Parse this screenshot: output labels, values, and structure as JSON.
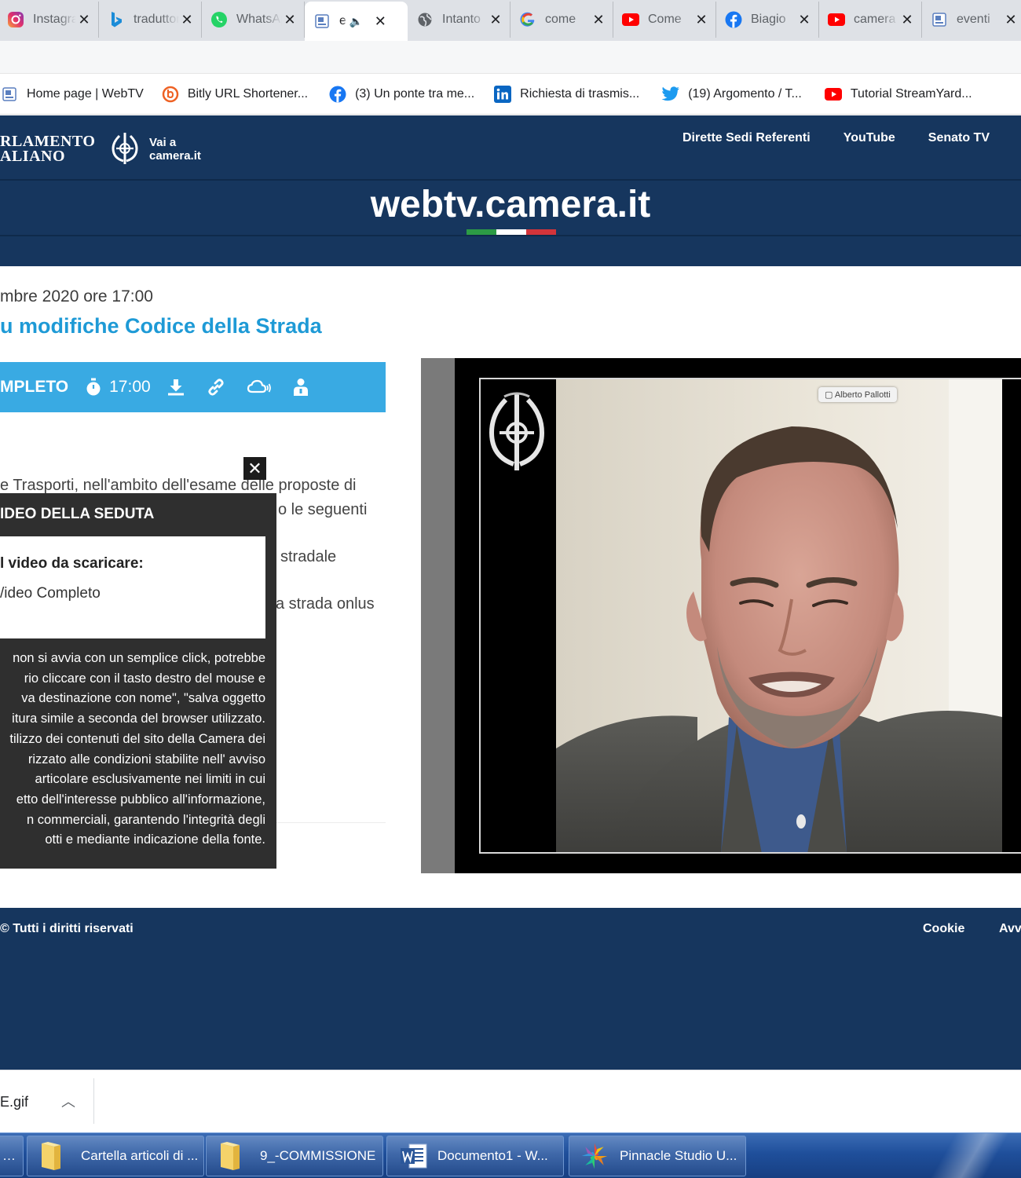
{
  "browser": {
    "tabs": [
      {
        "title": "Instagram",
        "icon": "instagram-icon",
        "active": false
      },
      {
        "title": "traduttore",
        "icon": "bing-icon",
        "active": false
      },
      {
        "title": "WhatsApp",
        "icon": "whatsapp-icon",
        "active": false
      },
      {
        "title": "e",
        "icon": "webtv-icon",
        "active": true
      },
      {
        "title": "Intanto",
        "icon": "globe-icon",
        "active": false
      },
      {
        "title": "come",
        "icon": "google-icon",
        "active": false
      },
      {
        "title": "Come",
        "icon": "youtube-icon",
        "active": false
      },
      {
        "title": "Biagio",
        "icon": "facebook-icon",
        "active": false
      },
      {
        "title": "camera",
        "icon": "youtube-icon",
        "active": false
      },
      {
        "title": "eventi",
        "icon": "webtv-icon",
        "active": false
      }
    ],
    "bookmarks": [
      {
        "label": "Home page | WebTV",
        "icon": "webtv-icon"
      },
      {
        "label": "Bitly URL Shortener...",
        "icon": "bitly-icon"
      },
      {
        "label": "(3) Un ponte tra me...",
        "icon": "facebook-icon"
      },
      {
        "label": "Richiesta di trasmis...",
        "icon": "linkedin-icon"
      },
      {
        "label": "(19) Argomento / T...",
        "icon": "twitter-icon"
      },
      {
        "label": "Tutorial StreamYard...",
        "icon": "youtube-icon"
      }
    ]
  },
  "site": {
    "logo_line1": "RLAMENTO",
    "logo_line2": "ALIANO",
    "vai_line1": "Vai a",
    "vai_line2": "camera.it",
    "nav": [
      "Dirette Sedi Referenti",
      "YouTube",
      "Senato TV"
    ],
    "title": "webtv.camera.it",
    "colors": {
      "navy": "#16365e",
      "accent_blue": "#39aae3",
      "title_blue": "#1e9ad6",
      "green": "#2c9b45",
      "white": "#ffffff",
      "red": "#d3343a"
    }
  },
  "content": {
    "datetime": "mbre 2020 ore 17:00",
    "title": "u modifiche Codice della Strada",
    "actionbar": {
      "label": "MPLETO",
      "time": "17:00"
    },
    "text_lines": [
      "e Trasporti, nell'ambito dell'esame delle proposte di",
      "o le seguenti",
      "stradale",
      "a strada onlus"
    ]
  },
  "popup": {
    "title": "IDEO DELLA SEDUTA",
    "question": "l video da scaricare:",
    "option": "/ideo Completo",
    "notice": [
      "non si avvia con un semplice click, potrebbe",
      "rio cliccare con il tasto destro del mouse e",
      "va destinazione con nome\", \"salva oggetto",
      "itura simile a seconda del browser utilizzato.",
      "tilizzo dei contenuti del sito della Camera dei",
      "rizzato alle condizioni stabilite nell' avviso",
      "articolare esclusivamente nei limiti in cui",
      "etto dell'interesse pubblico all'informazione,",
      "n commerciali, garantendo l'integrità degli",
      "otti e mediante indicazione della fonte."
    ],
    "close": "✕"
  },
  "video": {
    "speaker_badge": "Alberto Pallotti"
  },
  "footer": {
    "copyright": "© Tutti i diritti riservati",
    "links": [
      "Cookie",
      "Avvi"
    ]
  },
  "downloads": {
    "file": "E.gif"
  },
  "taskbar": [
    {
      "label": "Cartella articoli di ...",
      "icon": "folder-icon"
    },
    {
      "label": "9_-COMMISSIONE",
      "icon": "folder-icon"
    },
    {
      "label": "Documento1 - W...",
      "icon": "word-icon"
    },
    {
      "label": "Pinnacle Studio U...",
      "icon": "pinnacle-icon"
    }
  ]
}
